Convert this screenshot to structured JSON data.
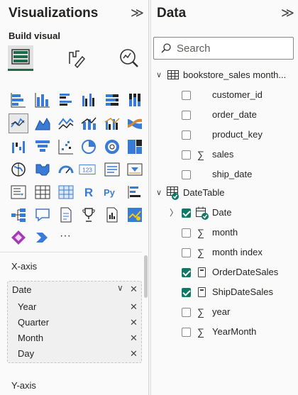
{
  "viz_pane": {
    "title": "Visualizations",
    "collapse_glyph": "≫",
    "build_label": "Build visual",
    "tools": [
      "build-visual-icon",
      "format-visual-icon",
      "analytics-icon"
    ],
    "xaxis_label": "X-axis",
    "xaxis_field": "Date",
    "xaxis_subfields": [
      "Year",
      "Quarter",
      "Month",
      "Day"
    ],
    "yaxis_label": "Y-axis",
    "more_glyph": "···"
  },
  "data_pane": {
    "title": "Data",
    "collapse_glyph": "≫",
    "search_placeholder": "Search",
    "tables": [
      {
        "name": "bookstore_sales month...",
        "fields": [
          {
            "name": "customer_id",
            "sigma": false,
            "checked": false
          },
          {
            "name": "order_date",
            "sigma": false,
            "checked": false
          },
          {
            "name": "product_key",
            "sigma": false,
            "checked": false
          },
          {
            "name": "sales",
            "sigma": true,
            "checked": false
          },
          {
            "name": "ship_date",
            "sigma": false,
            "checked": false
          }
        ]
      },
      {
        "name": "DateTable",
        "fields": [
          {
            "name": "Date",
            "checked": true
          },
          {
            "name": "month",
            "sigma": true,
            "checked": false
          },
          {
            "name": "month index",
            "sigma": true,
            "checked": false
          },
          {
            "name": "OrderDateSales",
            "measure": true,
            "checked": true
          },
          {
            "name": "ShipDateSales",
            "measure": true,
            "checked": true
          },
          {
            "name": "year",
            "sigma": true,
            "checked": false
          },
          {
            "name": "YearMonth",
            "sigma": true,
            "checked": false
          }
        ]
      }
    ]
  },
  "colors": {
    "accent": "#117865",
    "selected_tool": "#1d6b4a",
    "icon_blue": "#3a7bd5",
    "icon_dark": "#252423"
  }
}
